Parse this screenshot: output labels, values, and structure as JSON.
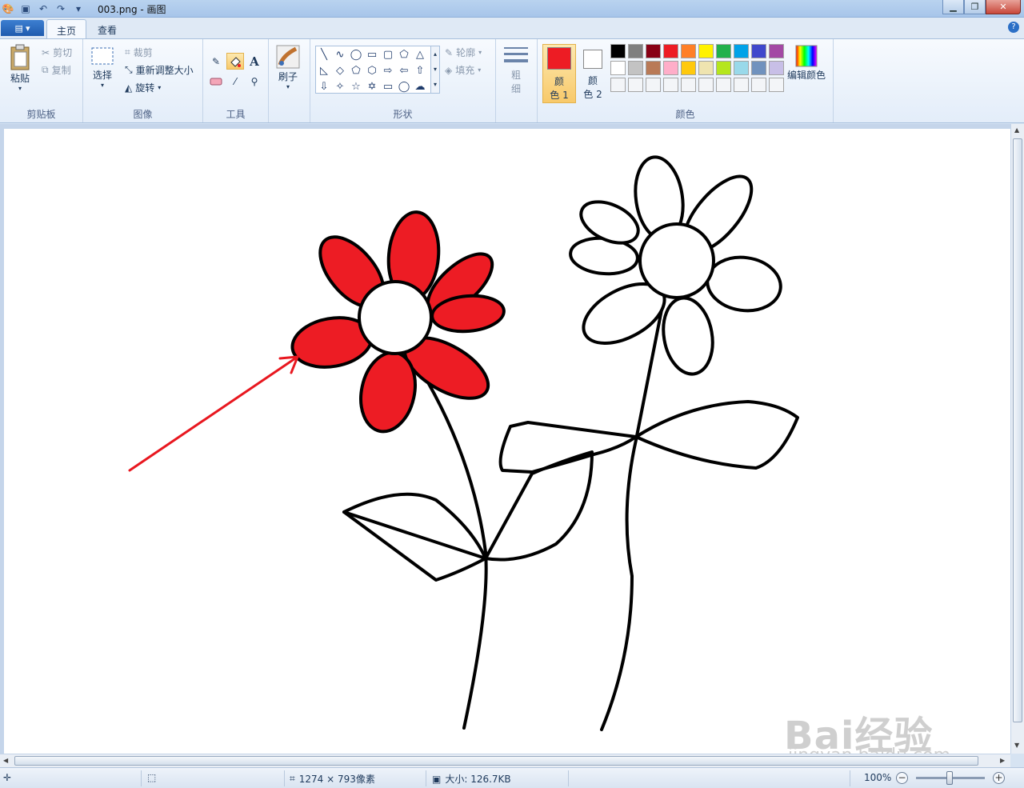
{
  "window": {
    "title": "003.png - 画图"
  },
  "tabs": [
    {
      "label": "主页",
      "active": true
    },
    {
      "label": "查看",
      "active": false
    }
  ],
  "clipboard": {
    "group_label": "剪贴板",
    "paste": "粘贴",
    "cut": "剪切",
    "copy": "复制"
  },
  "image": {
    "group_label": "图像",
    "select": "选择",
    "crop": "裁剪",
    "resize": "重新调整大小",
    "rotate": "旋转"
  },
  "tools": {
    "group_label": "工具",
    "items": [
      "pencil-icon",
      "fill-icon",
      "text-icon",
      "eraser-icon",
      "color-picker-icon",
      "magnifier-icon"
    ],
    "selected": "fill-icon"
  },
  "brushes": {
    "label": "刷子"
  },
  "shapes": {
    "group_label": "形状",
    "outline": "轮廓",
    "fill": "填充"
  },
  "size": {
    "label1": "粗",
    "label2": "细"
  },
  "colors": {
    "group_label": "颜色",
    "color1_label_a": "颜",
    "color1_label_b": "色 1",
    "color2_label_a": "颜",
    "color2_label_b": "色 2",
    "color1": "#ed1c24",
    "color2": "#ffffff",
    "edit_colors": "编辑颜色",
    "palette_row1": [
      "#000000",
      "#7f7f7f",
      "#880015",
      "#ed1c24",
      "#ff7f27",
      "#fff200",
      "#22b14c",
      "#00a2e8",
      "#3f48cc",
      "#a349a4"
    ],
    "palette_row2": [
      "#ffffff",
      "#c3c3c3",
      "#b97a57",
      "#ffaec9",
      "#ffc90e",
      "#efe4b0",
      "#b5e61d",
      "#99d9ea",
      "#7092be",
      "#c8bfe7"
    ],
    "palette_row3_empty": 10
  },
  "canvas": {
    "fill_color": "#ed1c24",
    "arrow_color": "#e8171f"
  },
  "status": {
    "dimensions": "1274 × 793像素",
    "size": "大小: 126.7KB",
    "zoom": "100%"
  },
  "watermark": {
    "brand": "Bai经验",
    "url": "jingyan.baidu.com"
  }
}
